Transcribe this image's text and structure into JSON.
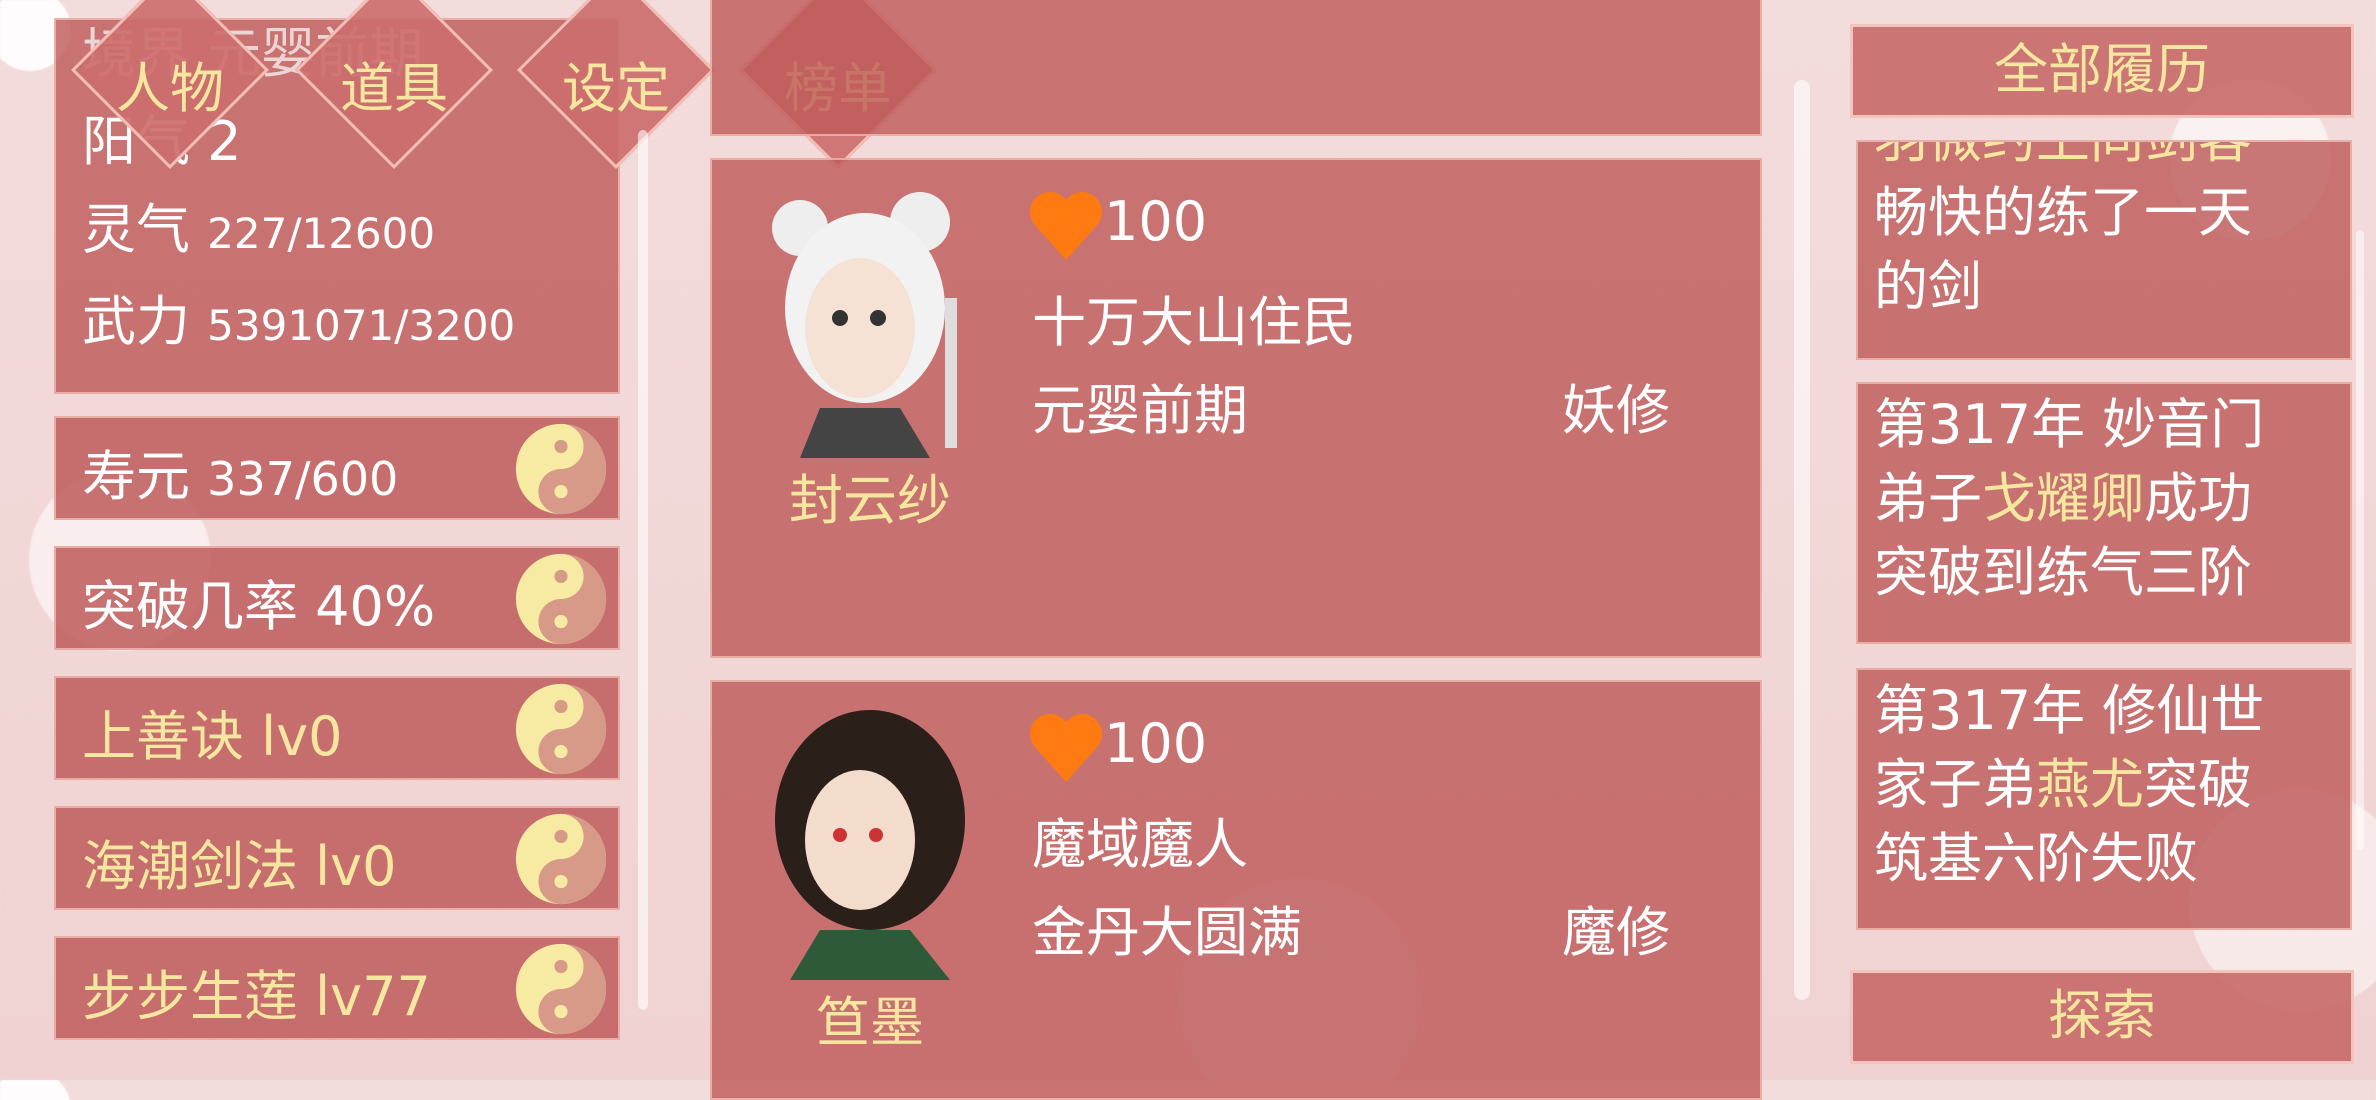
{
  "nav": {
    "tabs": [
      "人物",
      "道具",
      "设定",
      "榜单"
    ]
  },
  "stats": {
    "partial_top": "境界 元婴前期",
    "yangqi_label": "阳气",
    "yangqi_value": "2",
    "lingqi_label": "灵气",
    "lingqi_value": "227/12600",
    "wuli_label": "武力",
    "wuli_value": "5391071/3200"
  },
  "skills": [
    {
      "label": "寿元",
      "value": "337/600"
    },
    {
      "label": "突破几率",
      "value": "40%"
    },
    {
      "label": "上善诀 lv0"
    },
    {
      "label": "海潮剑法 lv0"
    },
    {
      "label": "步步生莲 lv77"
    }
  ],
  "characters": [
    {
      "name": "封云纱",
      "affection": "100",
      "origin": "十万大山住民",
      "realm": "元婴前期",
      "type": "妖修"
    },
    {
      "name": "笪墨",
      "affection": "100",
      "origin": "魔域魔人",
      "realm": "金丹大圆满",
      "type": "魔修"
    }
  ],
  "history": {
    "header": "全部履历",
    "entries": [
      {
        "cut_line": "羽微约上同剑客一",
        "lines": [
          "畅快的练了一天",
          "的剑"
        ]
      },
      {
        "l1": "第317年 妙音门",
        "l2_pre": "弟子",
        "l2_hl": "戈耀卿",
        "l2_post": "成功",
        "l3": "突破到练气三阶"
      },
      {
        "l1": "第317年 修仙世",
        "l2_pre": "家子弟",
        "l2_hl": "燕尤",
        "l2_post": "突破",
        "l3": "筑基六阶失败"
      }
    ],
    "explore": "探索"
  },
  "colors": {
    "highlight": "#f5e6a0",
    "panel": "#be5a5a",
    "heart": "#ff7a10"
  }
}
